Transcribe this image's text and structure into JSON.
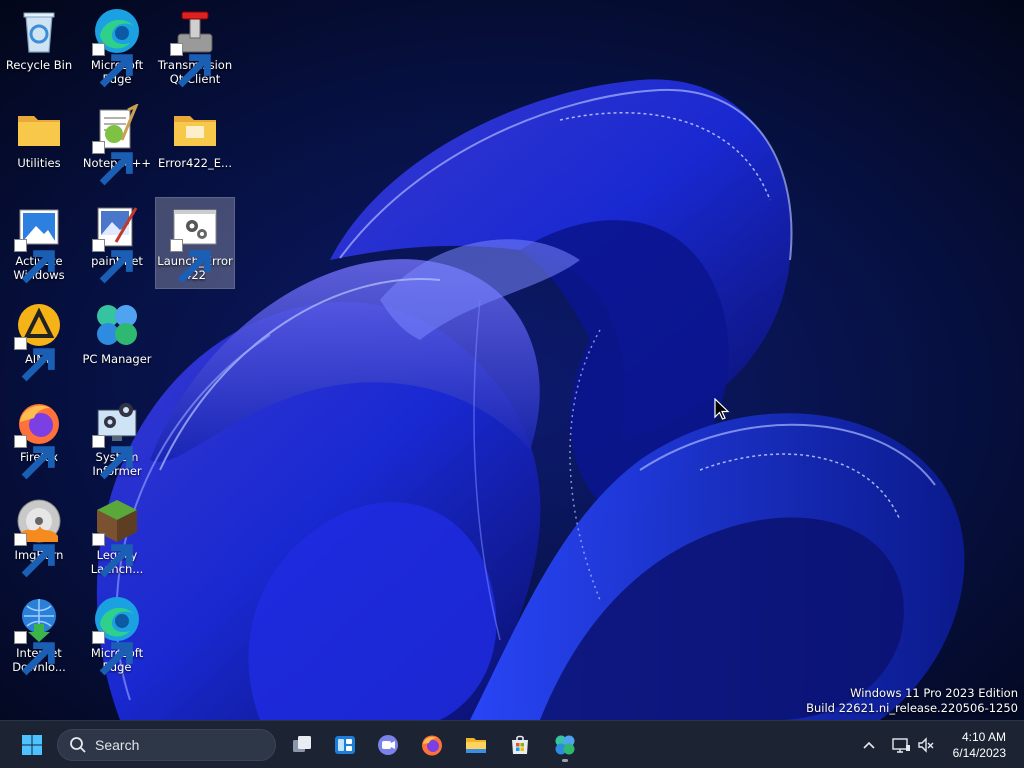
{
  "desktop": {
    "icons": [
      {
        "label": "Recycle Bin",
        "icon": "recycle-bin-icon"
      },
      {
        "label": "Microsoft Edge",
        "icon": "edge-icon"
      },
      {
        "label": "Transmission Qt Client",
        "icon": "transmission-icon"
      },
      {
        "label": "Utilities",
        "icon": "folder-icon"
      },
      {
        "label": "Notepad++",
        "icon": "notepadpp-icon"
      },
      {
        "label": "Error422_E...",
        "icon": "folder-icon"
      },
      {
        "label": "Activate Windows",
        "icon": "activate-windows-icon"
      },
      {
        "label": "paint.net",
        "icon": "paintnet-icon"
      },
      {
        "label": "Launch_Error 422",
        "icon": "gears-icon",
        "selected": true
      },
      {
        "label": "AIMP",
        "icon": "aimp-icon"
      },
      {
        "label": "PC Manager",
        "icon": "pc-manager-icon"
      },
      {
        "label": "Firefox",
        "icon": "firefox-icon"
      },
      {
        "label": "System Informer",
        "icon": "system-informer-icon"
      },
      {
        "label": "ImgBurn",
        "icon": "imgburn-icon"
      },
      {
        "label": "Legacy Launch...",
        "icon": "minecraft-icon"
      },
      {
        "label": "Internet Downlo...",
        "icon": "idm-icon"
      },
      {
        "label": "Microsoft Edge",
        "icon": "edge-icon"
      }
    ]
  },
  "watermark": {
    "line1": "Windows 11 Pro 2023 Edition",
    "line2": "Build 22621.ni_release.220506-1250"
  },
  "taskbar": {
    "search_placeholder": "Search",
    "pinned": [
      "start-icon",
      "task-view-icon",
      "widgets-icon",
      "teams-icon",
      "firefox-icon",
      "file-explorer-icon",
      "store-icon",
      "pc-manager-icon"
    ],
    "clock": {
      "time": "4:10 AM",
      "date": "6/14/2023"
    }
  },
  "colors": {
    "accent": "#0078d4",
    "taskbar": "#1c2434"
  }
}
